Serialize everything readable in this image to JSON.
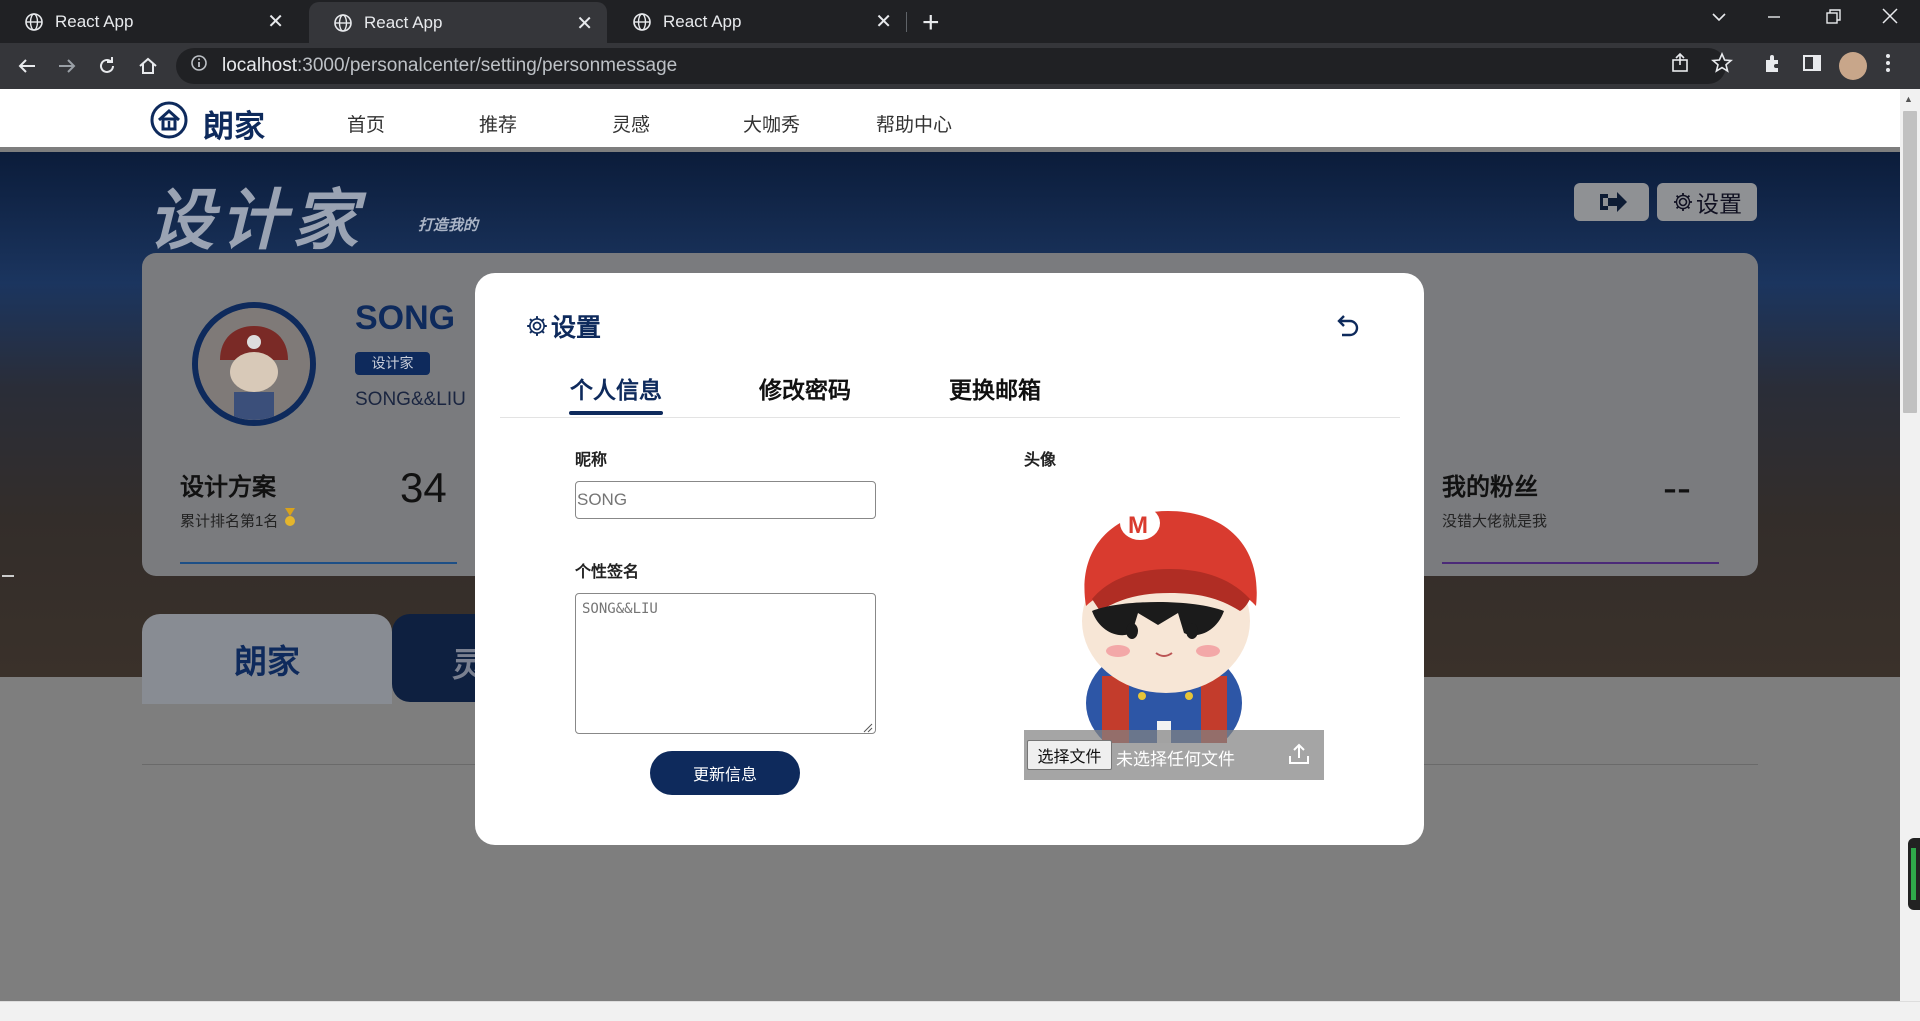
{
  "browser": {
    "tabs": [
      {
        "title": "React App"
      },
      {
        "title": "React App"
      },
      {
        "title": "React App"
      }
    ],
    "url_host": "localhost",
    "url_path": ":3000/personalcenter/setting/personmessage"
  },
  "site": {
    "logo_text": "朗家",
    "nav": [
      "首页",
      "推荐",
      "灵感",
      "大咖秀",
      "帮助中心"
    ]
  },
  "hero": {
    "title": "设计家",
    "subtitle": "打造我的",
    "settings_label": "设置"
  },
  "profile": {
    "name": "SONG",
    "badge": "设计家",
    "signature": "SONG&&LIU",
    "stats": [
      {
        "title": "设计方案",
        "sub": "累计排名第1名",
        "value": "34"
      },
      {
        "title": "我的粉丝",
        "sub": "没错大佬就是我",
        "value": "--"
      }
    ]
  },
  "bottom_tabs": {
    "first": "朗家",
    "second": "灵"
  },
  "modal": {
    "title": "设置",
    "tabs": [
      "个人信息",
      "修改密码",
      "更换邮箱"
    ],
    "nickname_label": "昵称",
    "nickname_placeholder": "SONG",
    "signature_label": "个性签名",
    "signature_placeholder": "SONG&&LIU",
    "update_button": "更新信息",
    "avatar_label": "头像",
    "choose_file": "选择文件",
    "no_file": "未选择任何文件"
  },
  "colors": {
    "brand": "#0e2a5c",
    "overlay": "#7e7e7e"
  }
}
